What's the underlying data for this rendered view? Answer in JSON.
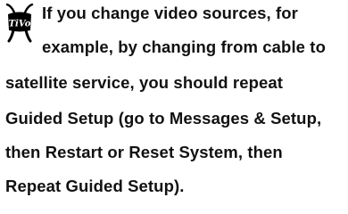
{
  "note": {
    "logo_icon": "tivo-logo-icon",
    "logo_text": "TiVo",
    "lines": [
      "If you change video sources, for",
      "example, by changing from cable to",
      "satellite service, you should repeat",
      "Guided Setup (go to Messages & Setup,",
      "then Restart or Reset System, then",
      "Repeat Guided Setup)."
    ]
  },
  "colors": {
    "text": "#111111",
    "logo": "#000000",
    "background": "#ffffff"
  }
}
